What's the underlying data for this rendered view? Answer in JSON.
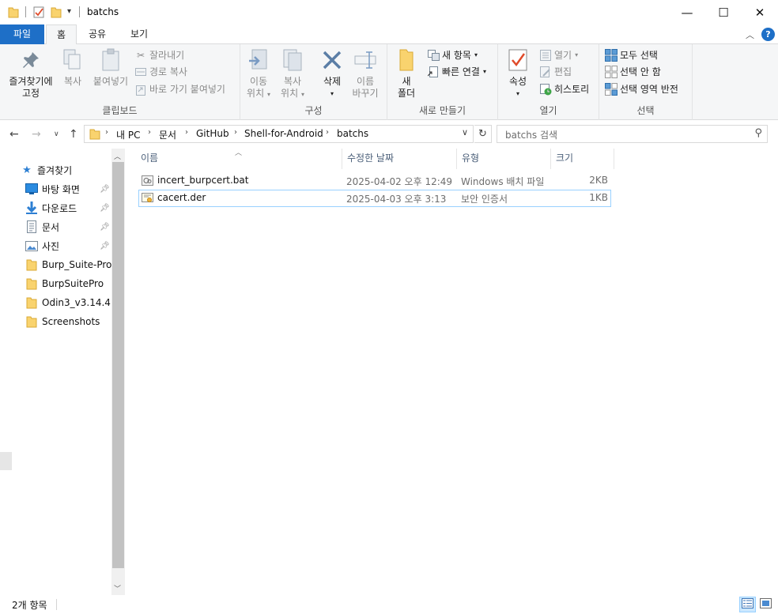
{
  "window": {
    "title": "batchs",
    "controls": {
      "minimize": "—",
      "maximize": "☐",
      "close": "✕"
    }
  },
  "ribbon_tabs": [
    "파일",
    "홈",
    "공유",
    "보기"
  ],
  "ribbon": {
    "clipboard": {
      "label": "클립보드",
      "pin_quick_access": [
        "즐겨찾기에",
        "고정"
      ],
      "copy": "복사",
      "paste": "붙여넣기",
      "cut": "잘라내기",
      "copy_path": "경로 복사",
      "paste_shortcut": "바로 가기 붙여넣기"
    },
    "organize": {
      "label": "구성",
      "move_to": [
        "이동",
        "위치"
      ],
      "copy_to": [
        "복사",
        "위치"
      ],
      "delete": "삭제",
      "rename": [
        "이름",
        "바꾸기"
      ]
    },
    "new": {
      "label": "새로 만들기",
      "new_folder": [
        "새",
        "폴더"
      ],
      "new_item": "새 항목",
      "easy_access": "빠른 연결"
    },
    "open": {
      "label": "열기",
      "properties": "속성",
      "open": "열기",
      "edit": "편집",
      "history": "히스토리"
    },
    "select": {
      "label": "선택",
      "select_all": "모두 선택",
      "select_none": "선택 안 함",
      "invert": "선택 영역 반전"
    }
  },
  "address": {
    "breadcrumbs": [
      "내 PC",
      "문서",
      "GitHub",
      "Shell-for-Android",
      "batchs"
    ],
    "search_placeholder": "batchs 검색"
  },
  "nav_pane": {
    "quick_access": "즐겨찾기",
    "items": [
      {
        "label": "바탕 화면",
        "icon": "desktop-icon",
        "pinned": true
      },
      {
        "label": "다운로드",
        "icon": "download-icon",
        "pinned": true
      },
      {
        "label": "문서",
        "icon": "document-icon",
        "pinned": true
      },
      {
        "label": "사진",
        "icon": "picture-icon",
        "pinned": true
      },
      {
        "label": "Burp_Suite-Pro_",
        "icon": "folder-icon",
        "pinned": false
      },
      {
        "label": "BurpSuitePro",
        "icon": "folder-icon",
        "pinned": false
      },
      {
        "label": "Odin3_v3.14.4",
        "icon": "folder-icon",
        "pinned": false
      },
      {
        "label": "Screenshots",
        "icon": "folder-icon",
        "pinned": false
      }
    ]
  },
  "file_list": {
    "columns": [
      "이름",
      "수정한 날짜",
      "유형",
      "크기"
    ],
    "rows": [
      {
        "name": "incert_burpcert.bat",
        "date": "2025-04-02 오후 12:49",
        "type": "Windows 배치 파일",
        "size": "2KB",
        "icon": "batch-file-icon"
      },
      {
        "name": "cacert.der",
        "date": "2025-04-03 오후 3:13",
        "type": "보안 인증서",
        "size": "1KB",
        "icon": "certificate-icon"
      }
    ]
  },
  "status": {
    "item_count": "2개 항목"
  },
  "colors": {
    "accent": "#1e6fc7",
    "folder": "#f9d36e",
    "selection_border": "#99d1ff"
  }
}
